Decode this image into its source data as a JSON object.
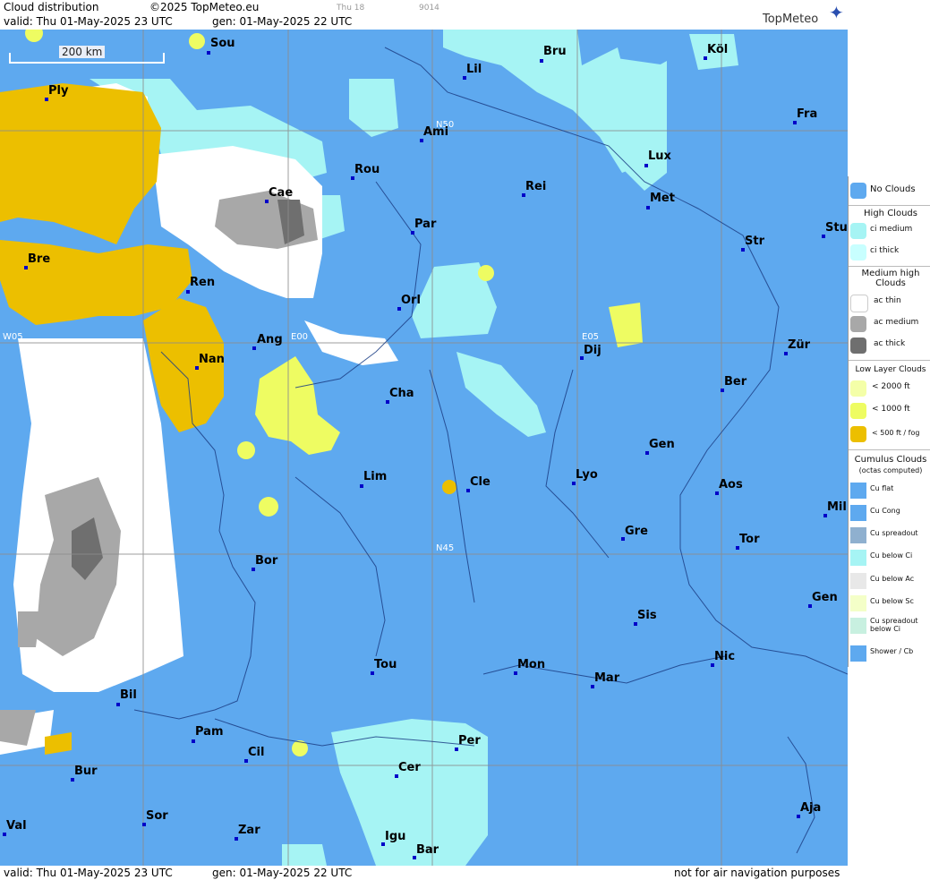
{
  "header": {
    "title": "Cloud distribution",
    "copyright": "©2025 TopMeteo.eu",
    "valid": "valid:  Thu  01-May-2025  23 UTC",
    "gen": "gen: 01-May-2025 22 UTC",
    "small_day": "Thu 18",
    "small_code": "9014",
    "logo": "TopMeteo"
  },
  "footer": {
    "valid": "valid:  Thu  01-May-2025  23 UTC",
    "gen": "gen: 01-May-2025 22 UTC",
    "disclaimer": "not for air navigation purposes"
  },
  "scale": {
    "label": "200 km"
  },
  "grid_labels": {
    "w05": "W05",
    "e00": "E00",
    "e05": "E05",
    "n50": "N50",
    "n45": "N45"
  },
  "cities": [
    {
      "id": "sou",
      "name": "Sou"
    },
    {
      "id": "ply",
      "name": "Ply"
    },
    {
      "id": "bru",
      "name": "Bru"
    },
    {
      "id": "kol",
      "name": "Köl"
    },
    {
      "id": "lil",
      "name": "Lil"
    },
    {
      "id": "ami",
      "name": "Ami"
    },
    {
      "id": "fra",
      "name": "Fra"
    },
    {
      "id": "lux",
      "name": "Lux"
    },
    {
      "id": "rou",
      "name": "Rou"
    },
    {
      "id": "cae",
      "name": "Cae"
    },
    {
      "id": "rei",
      "name": "Rei"
    },
    {
      "id": "met",
      "name": "Met"
    },
    {
      "id": "par",
      "name": "Par"
    },
    {
      "id": "stu",
      "name": "Stu"
    },
    {
      "id": "str",
      "name": "Str"
    },
    {
      "id": "bre",
      "name": "Bre"
    },
    {
      "id": "ren",
      "name": "Ren"
    },
    {
      "id": "orl",
      "name": "Orl"
    },
    {
      "id": "ang",
      "name": "Ang"
    },
    {
      "id": "dij",
      "name": "Dij"
    },
    {
      "id": "zur",
      "name": "Zür"
    },
    {
      "id": "nan",
      "name": "Nan"
    },
    {
      "id": "ber",
      "name": "Ber"
    },
    {
      "id": "cha",
      "name": "Cha"
    },
    {
      "id": "gen1",
      "name": "Gen"
    },
    {
      "id": "lim",
      "name": "Lim"
    },
    {
      "id": "cle",
      "name": "Cle"
    },
    {
      "id": "lyo",
      "name": "Lyo"
    },
    {
      "id": "aos",
      "name": "Aos"
    },
    {
      "id": "mil",
      "name": "Mil"
    },
    {
      "id": "gre",
      "name": "Gre"
    },
    {
      "id": "tor",
      "name": "Tor"
    },
    {
      "id": "bor",
      "name": "Bor"
    },
    {
      "id": "gen2",
      "name": "Gen"
    },
    {
      "id": "sis",
      "name": "Sis"
    },
    {
      "id": "nic",
      "name": "Nic"
    },
    {
      "id": "tou",
      "name": "Tou"
    },
    {
      "id": "mon",
      "name": "Mon"
    },
    {
      "id": "mar",
      "name": "Mar"
    },
    {
      "id": "bil",
      "name": "Bil"
    },
    {
      "id": "pam",
      "name": "Pam"
    },
    {
      "id": "cil",
      "name": "Cil"
    },
    {
      "id": "per",
      "name": "Per"
    },
    {
      "id": "bur",
      "name": "Bur"
    },
    {
      "id": "cer",
      "name": "Cer"
    },
    {
      "id": "sor",
      "name": "Sor"
    },
    {
      "id": "aja",
      "name": "Aja"
    },
    {
      "id": "val",
      "name": "Val"
    },
    {
      "id": "zar",
      "name": "Zar"
    },
    {
      "id": "igu",
      "name": "Igu"
    },
    {
      "id": "bar",
      "name": "Bar"
    }
  ],
  "legend": {
    "no_clouds": "No Clouds",
    "high_clouds": "High Clouds",
    "ci_medium": "ci medium",
    "ci_thick": "ci thick",
    "medium_high_clouds": "Medium high Clouds",
    "ac_thin": "ac thin",
    "ac_medium": "ac medium",
    "ac_thick": "ac thick",
    "low_layer_clouds": "Low Layer Clouds",
    "lt_2000": "< 2000 ft",
    "lt_1000": "< 1000 ft",
    "lt_500": "< 500 ft / fog",
    "cumulus_clouds": "Cumulus Clouds",
    "octas": "(octas computed)",
    "cu_flat": "Cu flat",
    "cu_cong": "Cu Cong",
    "cu_spreadout": "Cu spreadout",
    "cu_below_ci": "Cu below Ci",
    "cu_below_ac": "Cu below Ac",
    "cu_below_sc": "Cu below Sc",
    "cu_spreadout_below_ci": "Cu spreadout below Ci",
    "shower_cb": "Shower / Cb"
  },
  "colors": {
    "no_clouds": "#5ea9ef",
    "ci_medium": "#a6f4f4",
    "ci_thick": "#c8ffff",
    "ac_thin": "#ffffff",
    "ac_medium": "#a8a8a8",
    "ac_thick": "#6f6f6f",
    "low_2000": "#f4ffa8",
    "low_1000": "#eefc62",
    "low_500": "#ecbf00"
  }
}
